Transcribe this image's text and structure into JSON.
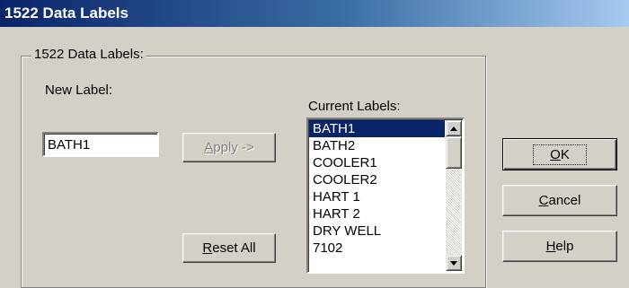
{
  "window": {
    "title": "1522 Data Labels"
  },
  "group": {
    "legend": "1522 Data Labels:"
  },
  "new_label": {
    "label": "New Label:",
    "value": "BATH1"
  },
  "buttons": {
    "apply": "Apply ->",
    "reset_all": "Reset All",
    "ok": "OK",
    "cancel": "Cancel",
    "help": "Help"
  },
  "current_labels": {
    "label": "Current Labels:",
    "items": [
      "BATH1",
      "BATH2",
      "COOLER1",
      "COOLER2",
      "HART 1",
      "HART 2",
      "DRY WELL",
      "7102"
    ],
    "selected": "BATH1"
  },
  "icons": {
    "scroll_up": "arrow-up-icon",
    "scroll_down": "arrow-down-icon"
  },
  "colors": {
    "title_bar": "#0a246a",
    "selection": "#0a246a",
    "dialog_face": "#d4d0c8"
  }
}
